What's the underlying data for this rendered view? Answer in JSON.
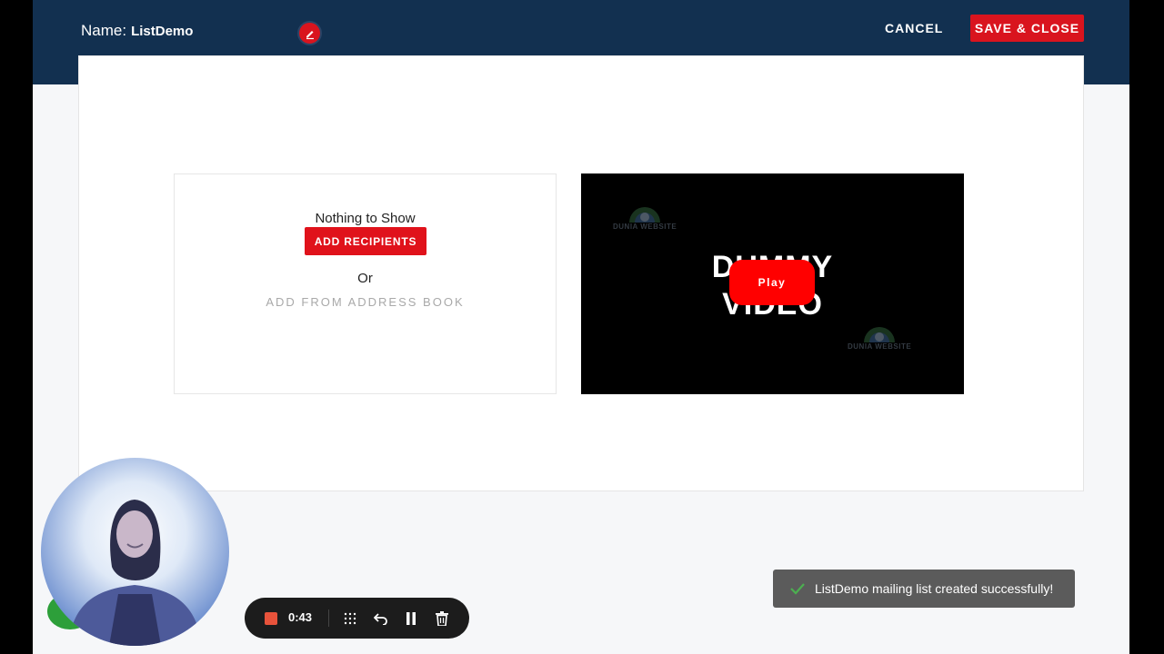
{
  "header": {
    "name_label": "Name:",
    "name_value": "ListDemo",
    "edit_icon": "pencil-icon",
    "cancel_label": "CANCEL",
    "save_label": "SAVE & CLOSE"
  },
  "recipients_panel": {
    "empty_text": "Nothing to Show",
    "add_button_label": "ADD RECIPIENTS",
    "or_text": "Or",
    "address_book_link": "ADD FROM ADDRESS BOOK"
  },
  "video": {
    "title_line1": "DUMMY",
    "title_line2": "VIDEO",
    "logo_text": "DUNIA WEBSITE",
    "play_label": "Play"
  },
  "toast": {
    "message": "ListDemo mailing list created successfully!",
    "icon": "check-icon"
  },
  "recorder": {
    "time": "0:43",
    "icons": [
      "stop-icon",
      "grid-icon",
      "undo-icon",
      "pause-icon",
      "trash-icon"
    ]
  },
  "colors": {
    "header_bg": "#123050",
    "accent_red": "#d9141e",
    "toast_bg": "#5b5b5b",
    "toast_check": "#4caf50"
  }
}
